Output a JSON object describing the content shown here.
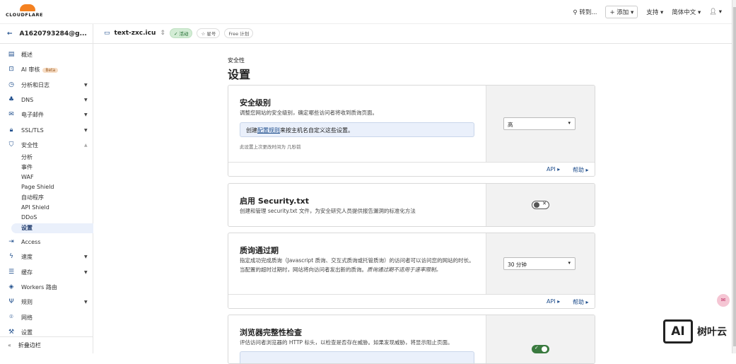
{
  "header": {
    "logo": "CLOUDFLARE",
    "search": "转到...",
    "add": "添加",
    "support": "支持",
    "language": "简体中文"
  },
  "account": {
    "name": "A1620793284@g..."
  },
  "zone": {
    "name": "text-zxc.icu",
    "status": "活动",
    "star": "星号",
    "plan": "Free 计划"
  },
  "sidebar": {
    "items": [
      "概述",
      "AI 审核",
      "分析和日志",
      "DNS",
      "电子邮件",
      "SSL/TLS",
      "安全性"
    ],
    "beta": "Beta",
    "security_sub": [
      "分析",
      "事件",
      "WAF",
      "Page Shield",
      "自动程序",
      "API Shield",
      "DDoS",
      "设置"
    ],
    "items2": [
      "Access",
      "速度",
      "缓存",
      "Workers 路由",
      "规则",
      "网络",
      "设置"
    ],
    "collapse": "折叠边栏"
  },
  "page": {
    "breadcrumb": "安全性",
    "title": "设置"
  },
  "cards": [
    {
      "title": "安全级别",
      "desc": "调整您网站的安全级别，确定哪些访问者将收到质询页面。",
      "info_pre": "创建",
      "info_link": "配置规则",
      "info_post": "来按主机名自定义这些设置。",
      "note": "此设置上次更改时间为 几秒前",
      "select": "高",
      "api": "API ▸",
      "help": "帮助 ▸"
    },
    {
      "title": "启用 Security.txt",
      "desc": "创建和管理 security.txt 文件，为安全研究人员提供报告漏洞的标准化方法",
      "toggle": false
    },
    {
      "title": "质询通过期",
      "desc": "指定成功完成质询（Javascript 质询、交互式质询或托管质询）的访问者可以访问您的网站的时长。当配置的超时过期时，网站将向访问者发出新的质询。",
      "desc_em": "质询通过期不适用于速率限制。",
      "select": "30 分钟",
      "api": "API ▸",
      "help": "帮助 ▸"
    },
    {
      "title": "浏览器完整性检查",
      "desc": "评估访问者浏览器的 HTTP 标头，以检查是否存在威胁。如果发现威胁，将显示阻止页面。",
      "toggle": true
    }
  ],
  "watermark": "树叶云"
}
